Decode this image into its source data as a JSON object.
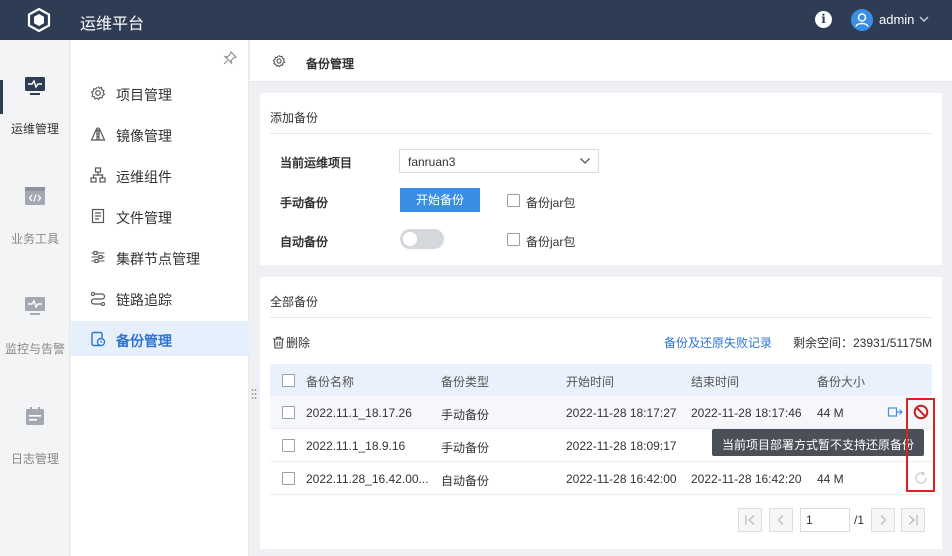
{
  "app": {
    "title": "运维平台",
    "user": "admin"
  },
  "rail": {
    "items": [
      {
        "label": "运维管理"
      },
      {
        "label": "业务工具"
      },
      {
        "label": "监控与告警"
      },
      {
        "label": "日志管理"
      }
    ]
  },
  "subnav": {
    "items": [
      {
        "label": "项目管理",
        "icon": "gear-icon"
      },
      {
        "label": "镜像管理",
        "icon": "mirror-icon"
      },
      {
        "label": "运维组件",
        "icon": "component-icon"
      },
      {
        "label": "文件管理",
        "icon": "file-icon"
      },
      {
        "label": "集群节点管理",
        "icon": "sliders-icon"
      },
      {
        "label": "链路追踪",
        "icon": "trace-icon"
      },
      {
        "label": "备份管理",
        "icon": "backup-icon"
      }
    ]
  },
  "page": {
    "title": "备份管理"
  },
  "add_backup": {
    "title": "添加备份",
    "project_label": "当前运维项目",
    "project_value": "fanruan3",
    "manual_label": "手动备份",
    "start_button": "开始备份",
    "jar_label_manual": "备份jar包",
    "auto_label": "自动备份",
    "jar_label_auto": "备份jar包"
  },
  "all_backups": {
    "title": "全部备份",
    "delete_label": "删除",
    "fail_link": "备份及还原失败记录",
    "space_label": "剩余空间：23931/51175M",
    "columns": [
      "备份名称",
      "备份类型",
      "开始时间",
      "结束时间",
      "备份大小"
    ],
    "rows": [
      {
        "name": "2022.11.1_18.17.26",
        "type": "手动备份",
        "start": "2022-11-28 18:17:27",
        "end": "2022-11-28 18:17:46",
        "size": "44 M"
      },
      {
        "name": "2022.11.1_18.9.16",
        "type": "手动备份",
        "start": "2022-11-28 18:09:17",
        "end": "",
        "size": ""
      },
      {
        "name": "2022.11.28_16.42.00...",
        "type": "自动备份",
        "start": "2022-11-28 16:42:00",
        "end": "2022-11-28 16:42:20",
        "size": "44 M"
      }
    ],
    "tooltip": "当前项目部署方式暂不支持还原备份",
    "pagination": {
      "current": "1",
      "total": "/1"
    }
  },
  "colors": {
    "topbar": "#2e3d54",
    "accent": "#3a8ee6",
    "active_nav_bg": "#e6f0fc",
    "danger": "#e02020"
  }
}
